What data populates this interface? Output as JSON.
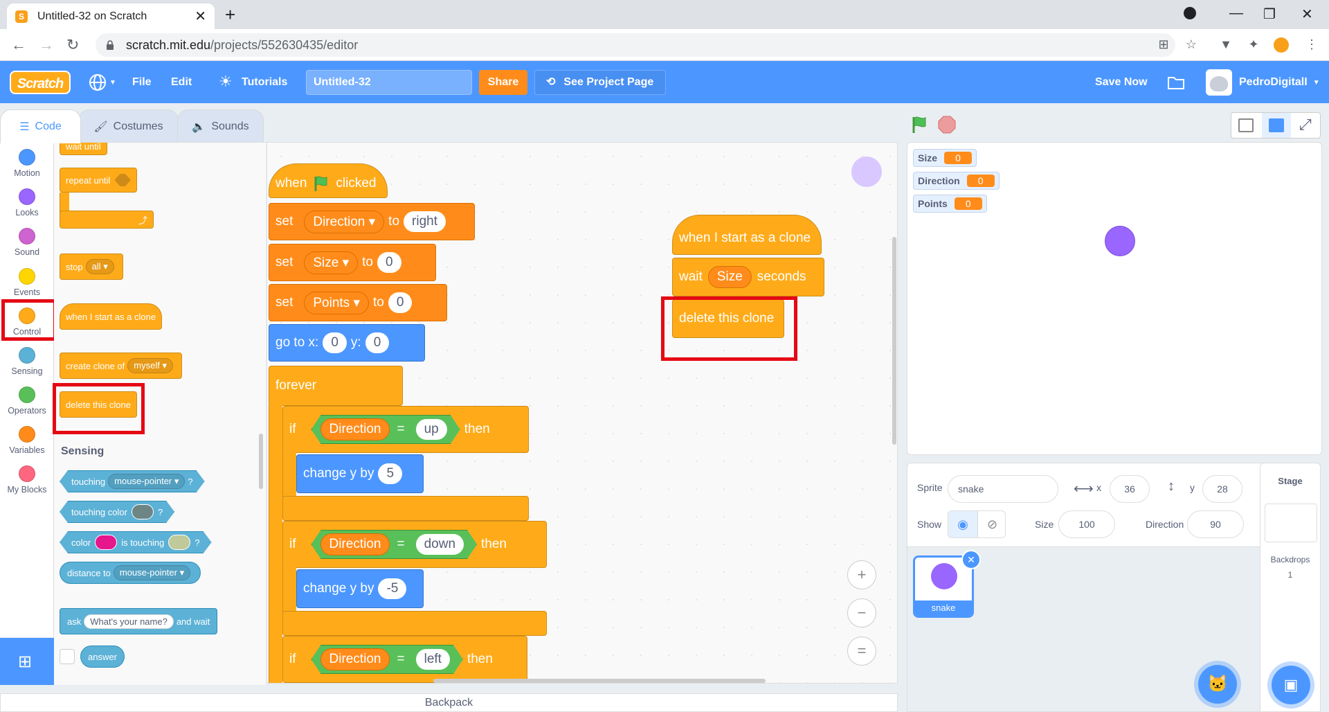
{
  "browser": {
    "tab_title": "Untitled-32 on Scratch",
    "url_host": "scratch.mit.edu",
    "url_path": "/projects/552630435/editor",
    "tab_close": "✕",
    "new_tab": "+",
    "minimize": "—",
    "maximize": "❐",
    "close": "✕"
  },
  "menubar": {
    "logo": "Scratch",
    "file": "File",
    "edit": "Edit",
    "tutorials": "Tutorials",
    "project_title": "Untitled-32",
    "share": "Share",
    "see_project_page": "See Project Page",
    "save_now": "Save Now",
    "username": "PedroDigitalI"
  },
  "editor_tabs": {
    "code": "Code",
    "costumes": "Costumes",
    "sounds": "Sounds"
  },
  "categories": [
    {
      "label": "Motion",
      "color": "#4c97ff"
    },
    {
      "label": "Looks",
      "color": "#9966ff"
    },
    {
      "label": "Sound",
      "color": "#cf63cf"
    },
    {
      "label": "Events",
      "color": "#ffd500"
    },
    {
      "label": "Control",
      "color": "#ffab19"
    },
    {
      "label": "Sensing",
      "color": "#5cb1d6"
    },
    {
      "label": "Operators",
      "color": "#59c059"
    },
    {
      "label": "Variables",
      "color": "#ff8c1a"
    },
    {
      "label": "My Blocks",
      "color": "#ff6680"
    }
  ],
  "palette": {
    "wait_until": "wait until",
    "repeat_until": "repeat until",
    "stop": "stop",
    "stop_option": "all",
    "when_clone": "when I start as a clone",
    "create_clone": "create clone of",
    "create_clone_option": "myself",
    "delete_clone": "delete this clone",
    "sensing_heading": "Sensing",
    "touching": "touching",
    "touching_option": "mouse-pointer",
    "touching_color": "touching color",
    "color": "color",
    "is_touching": "is touching",
    "distance_to": "distance to",
    "distance_option": "mouse-pointer",
    "ask": "ask",
    "ask_default": "What's your name?",
    "and_wait": "and wait",
    "answer": "answer",
    "question_mark": "?"
  },
  "script_main": {
    "when": "when",
    "clicked": "clicked",
    "set": "set",
    "to": "to",
    "var_direction": "Direction",
    "var_size": "Size",
    "var_points": "Points",
    "val_right": "right",
    "val_zero": "0",
    "go_to_x": "go to x:",
    "y": "y:",
    "forever": "forever",
    "if": "if",
    "then": "then",
    "equals": "=",
    "up": "up",
    "down": "down",
    "left": "left",
    "change_y_by": "change y by",
    "five": "5",
    "neg_five": "-5"
  },
  "script_clone": {
    "hat": "when I start as a clone",
    "wait": "wait",
    "seconds": "seconds",
    "var": "Size",
    "delete": "delete this clone"
  },
  "monitors": [
    {
      "label": "Size",
      "value": "0"
    },
    {
      "label": "Direction",
      "value": "0"
    },
    {
      "label": "Points",
      "value": "0"
    }
  ],
  "sprite_info": {
    "sprite_label": "Sprite",
    "sprite_name": "snake",
    "x_label": "x",
    "x_value": "36",
    "y_label": "y",
    "y_value": "28",
    "show_label": "Show",
    "size_label": "Size",
    "size_value": "100",
    "direction_label": "Direction",
    "direction_value": "90"
  },
  "sprites": [
    {
      "name": "snake"
    }
  ],
  "stage_panel": {
    "title": "Stage",
    "backdrops_label": "Backdrops",
    "backdrops_count": "1"
  },
  "backpack": "Backpack",
  "zoom": {
    "in": "+",
    "out": "−",
    "reset": "="
  }
}
